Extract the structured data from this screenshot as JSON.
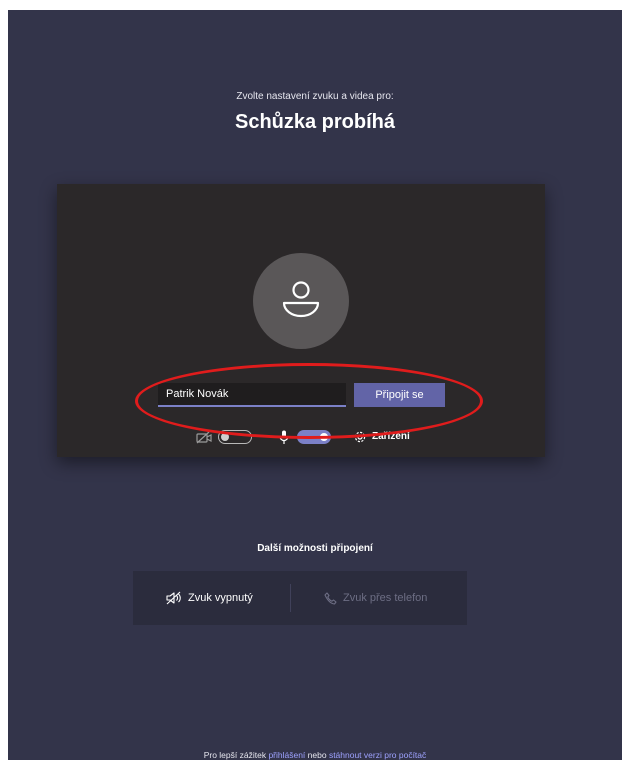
{
  "header": {
    "subtitle": "Zvolte nastavení zvuku a videa pro:",
    "title": "Schůzka probíhá"
  },
  "prejoin": {
    "avatar_icon": "person-icon",
    "name_value": "Patrik Novák",
    "join_label": "Připojit se",
    "camera": {
      "icon": "camera-off-icon",
      "enabled": false
    },
    "microphone": {
      "icon": "microphone-icon",
      "enabled": true
    },
    "devices": {
      "icon": "gear-icon",
      "label": "Zařízení"
    }
  },
  "more_options": {
    "label": "Další možnosti připojení",
    "audio_off": {
      "icon": "speaker-off-icon",
      "label": "Zvuk vypnutý"
    },
    "phone_audio": {
      "icon": "phone-icon",
      "label": "Zvuk přes telefon"
    }
  },
  "footer": {
    "prefix": "Pro lepší zážitek ",
    "signin_link": "přihlášení",
    "middle": " nebo ",
    "download_link": "stáhnout verzi pro počítač"
  },
  "colors": {
    "background": "#33344a",
    "preview": "#2b2829",
    "accent": "#6264a7",
    "toggle_on": "#7b80c7",
    "annotation": "#e01c1c",
    "link": "#9ea2ff"
  }
}
